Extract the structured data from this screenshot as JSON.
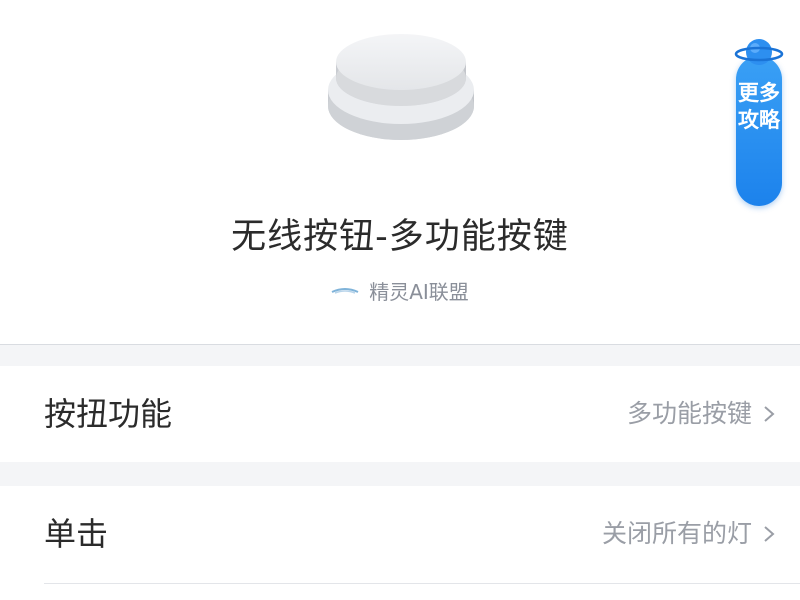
{
  "device": {
    "title": "无线按钮-多功能按键",
    "brand": "精灵AI联盟",
    "image_icon": "round-button-device"
  },
  "more_guides": {
    "label": "更多攻略",
    "icon": "planet-icon",
    "color": "#1c82ec"
  },
  "settings": [
    {
      "label": "按扭功能",
      "value": "多功能按键"
    },
    {
      "label": "单击",
      "value": "关闭所有的灯"
    }
  ],
  "colors": {
    "background": "#ffffff",
    "section_gap": "#f4f5f7",
    "value_text": "#9a9ea6",
    "label_text": "#2b2b2b"
  }
}
